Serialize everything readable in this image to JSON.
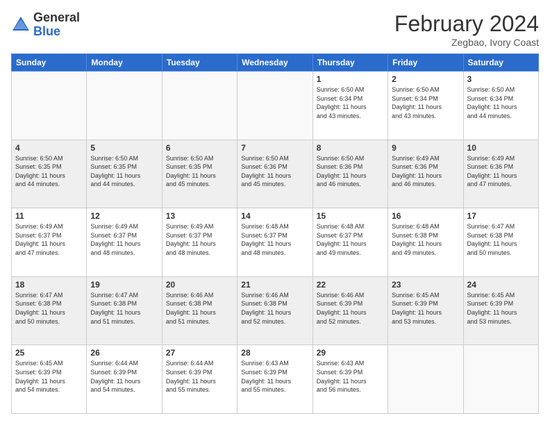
{
  "header": {
    "logo_general": "General",
    "logo_blue": "Blue",
    "month_title": "February 2024",
    "location": "Zegbao, Ivory Coast"
  },
  "days_of_week": [
    "Sunday",
    "Monday",
    "Tuesday",
    "Wednesday",
    "Thursday",
    "Friday",
    "Saturday"
  ],
  "weeks": [
    [
      {
        "day": "",
        "info": ""
      },
      {
        "day": "",
        "info": ""
      },
      {
        "day": "",
        "info": ""
      },
      {
        "day": "",
        "info": ""
      },
      {
        "day": "1",
        "info": "Sunrise: 6:50 AM\nSunset: 6:34 PM\nDaylight: 11 hours\nand 43 minutes."
      },
      {
        "day": "2",
        "info": "Sunrise: 6:50 AM\nSunset: 6:34 PM\nDaylight: 11 hours\nand 43 minutes."
      },
      {
        "day": "3",
        "info": "Sunrise: 6:50 AM\nSunset: 6:34 PM\nDaylight: 11 hours\nand 44 minutes."
      }
    ],
    [
      {
        "day": "4",
        "info": "Sunrise: 6:50 AM\nSunset: 6:35 PM\nDaylight: 11 hours\nand 44 minutes."
      },
      {
        "day": "5",
        "info": "Sunrise: 6:50 AM\nSunset: 6:35 PM\nDaylight: 11 hours\nand 44 minutes."
      },
      {
        "day": "6",
        "info": "Sunrise: 6:50 AM\nSunset: 6:35 PM\nDaylight: 11 hours\nand 45 minutes."
      },
      {
        "day": "7",
        "info": "Sunrise: 6:50 AM\nSunset: 6:36 PM\nDaylight: 11 hours\nand 45 minutes."
      },
      {
        "day": "8",
        "info": "Sunrise: 6:50 AM\nSunset: 6:36 PM\nDaylight: 11 hours\nand 46 minutes."
      },
      {
        "day": "9",
        "info": "Sunrise: 6:49 AM\nSunset: 6:36 PM\nDaylight: 11 hours\nand 46 minutes."
      },
      {
        "day": "10",
        "info": "Sunrise: 6:49 AM\nSunset: 6:36 PM\nDaylight: 11 hours\nand 47 minutes."
      }
    ],
    [
      {
        "day": "11",
        "info": "Sunrise: 6:49 AM\nSunset: 6:37 PM\nDaylight: 11 hours\nand 47 minutes."
      },
      {
        "day": "12",
        "info": "Sunrise: 6:49 AM\nSunset: 6:37 PM\nDaylight: 11 hours\nand 48 minutes."
      },
      {
        "day": "13",
        "info": "Sunrise: 6:49 AM\nSunset: 6:37 PM\nDaylight: 11 hours\nand 48 minutes."
      },
      {
        "day": "14",
        "info": "Sunrise: 6:48 AM\nSunset: 6:37 PM\nDaylight: 11 hours\nand 48 minutes."
      },
      {
        "day": "15",
        "info": "Sunrise: 6:48 AM\nSunset: 6:37 PM\nDaylight: 11 hours\nand 49 minutes."
      },
      {
        "day": "16",
        "info": "Sunrise: 6:48 AM\nSunset: 6:38 PM\nDaylight: 11 hours\nand 49 minutes."
      },
      {
        "day": "17",
        "info": "Sunrise: 6:47 AM\nSunset: 6:38 PM\nDaylight: 11 hours\nand 50 minutes."
      }
    ],
    [
      {
        "day": "18",
        "info": "Sunrise: 6:47 AM\nSunset: 6:38 PM\nDaylight: 11 hours\nand 50 minutes."
      },
      {
        "day": "19",
        "info": "Sunrise: 6:47 AM\nSunset: 6:38 PM\nDaylight: 11 hours\nand 51 minutes."
      },
      {
        "day": "20",
        "info": "Sunrise: 6:46 AM\nSunset: 6:38 PM\nDaylight: 11 hours\nand 51 minutes."
      },
      {
        "day": "21",
        "info": "Sunrise: 6:46 AM\nSunset: 6:38 PM\nDaylight: 11 hours\nand 52 minutes."
      },
      {
        "day": "22",
        "info": "Sunrise: 6:46 AM\nSunset: 6:39 PM\nDaylight: 11 hours\nand 52 minutes."
      },
      {
        "day": "23",
        "info": "Sunrise: 6:45 AM\nSunset: 6:39 PM\nDaylight: 11 hours\nand 53 minutes."
      },
      {
        "day": "24",
        "info": "Sunrise: 6:45 AM\nSunset: 6:39 PM\nDaylight: 11 hours\nand 53 minutes."
      }
    ],
    [
      {
        "day": "25",
        "info": "Sunrise: 6:45 AM\nSunset: 6:39 PM\nDaylight: 11 hours\nand 54 minutes."
      },
      {
        "day": "26",
        "info": "Sunrise: 6:44 AM\nSunset: 6:39 PM\nDaylight: 11 hours\nand 54 minutes."
      },
      {
        "day": "27",
        "info": "Sunrise: 6:44 AM\nSunset: 6:39 PM\nDaylight: 11 hours\nand 55 minutes."
      },
      {
        "day": "28",
        "info": "Sunrise: 6:43 AM\nSunset: 6:39 PM\nDaylight: 11 hours\nand 55 minutes."
      },
      {
        "day": "29",
        "info": "Sunrise: 6:43 AM\nSunset: 6:39 PM\nDaylight: 11 hours\nand 56 minutes."
      },
      {
        "day": "",
        "info": ""
      },
      {
        "day": "",
        "info": ""
      }
    ]
  ]
}
